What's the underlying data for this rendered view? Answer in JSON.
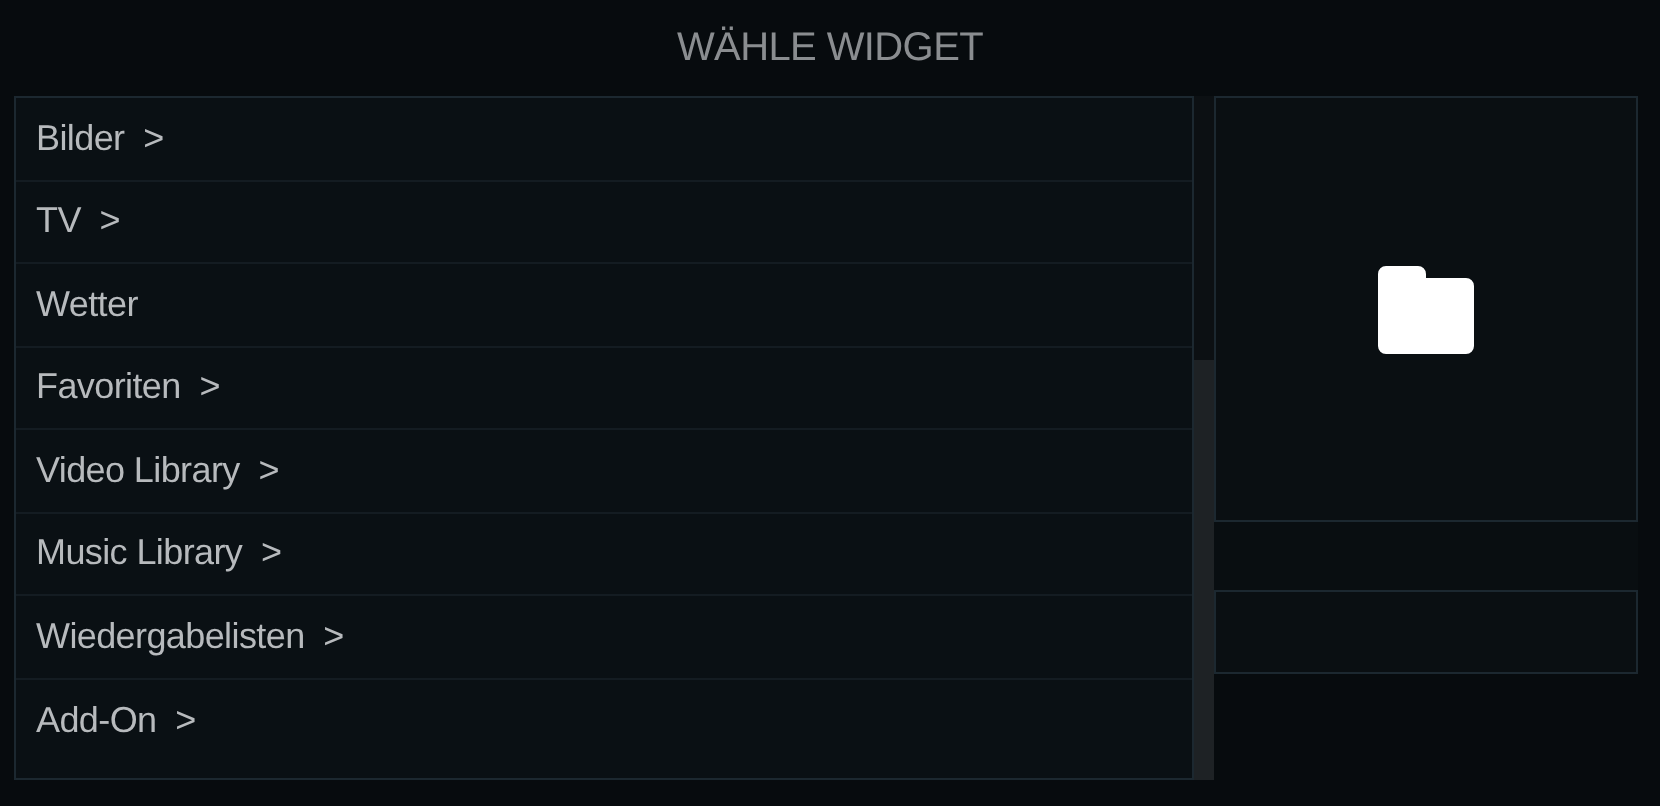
{
  "dialog": {
    "title": "WÄHLE WIDGET"
  },
  "items": [
    {
      "label": "Bilder",
      "submenu": true
    },
    {
      "label": "TV",
      "submenu": true
    },
    {
      "label": "Wetter",
      "submenu": false
    },
    {
      "label": "Favoriten",
      "submenu": true
    },
    {
      "label": "Video Library",
      "submenu": true
    },
    {
      "label": "Music Library",
      "submenu": true
    },
    {
      "label": "Wiedergabelisten",
      "submenu": true
    },
    {
      "label": "Add-On",
      "submenu": true
    }
  ],
  "submenu_marker": ">"
}
